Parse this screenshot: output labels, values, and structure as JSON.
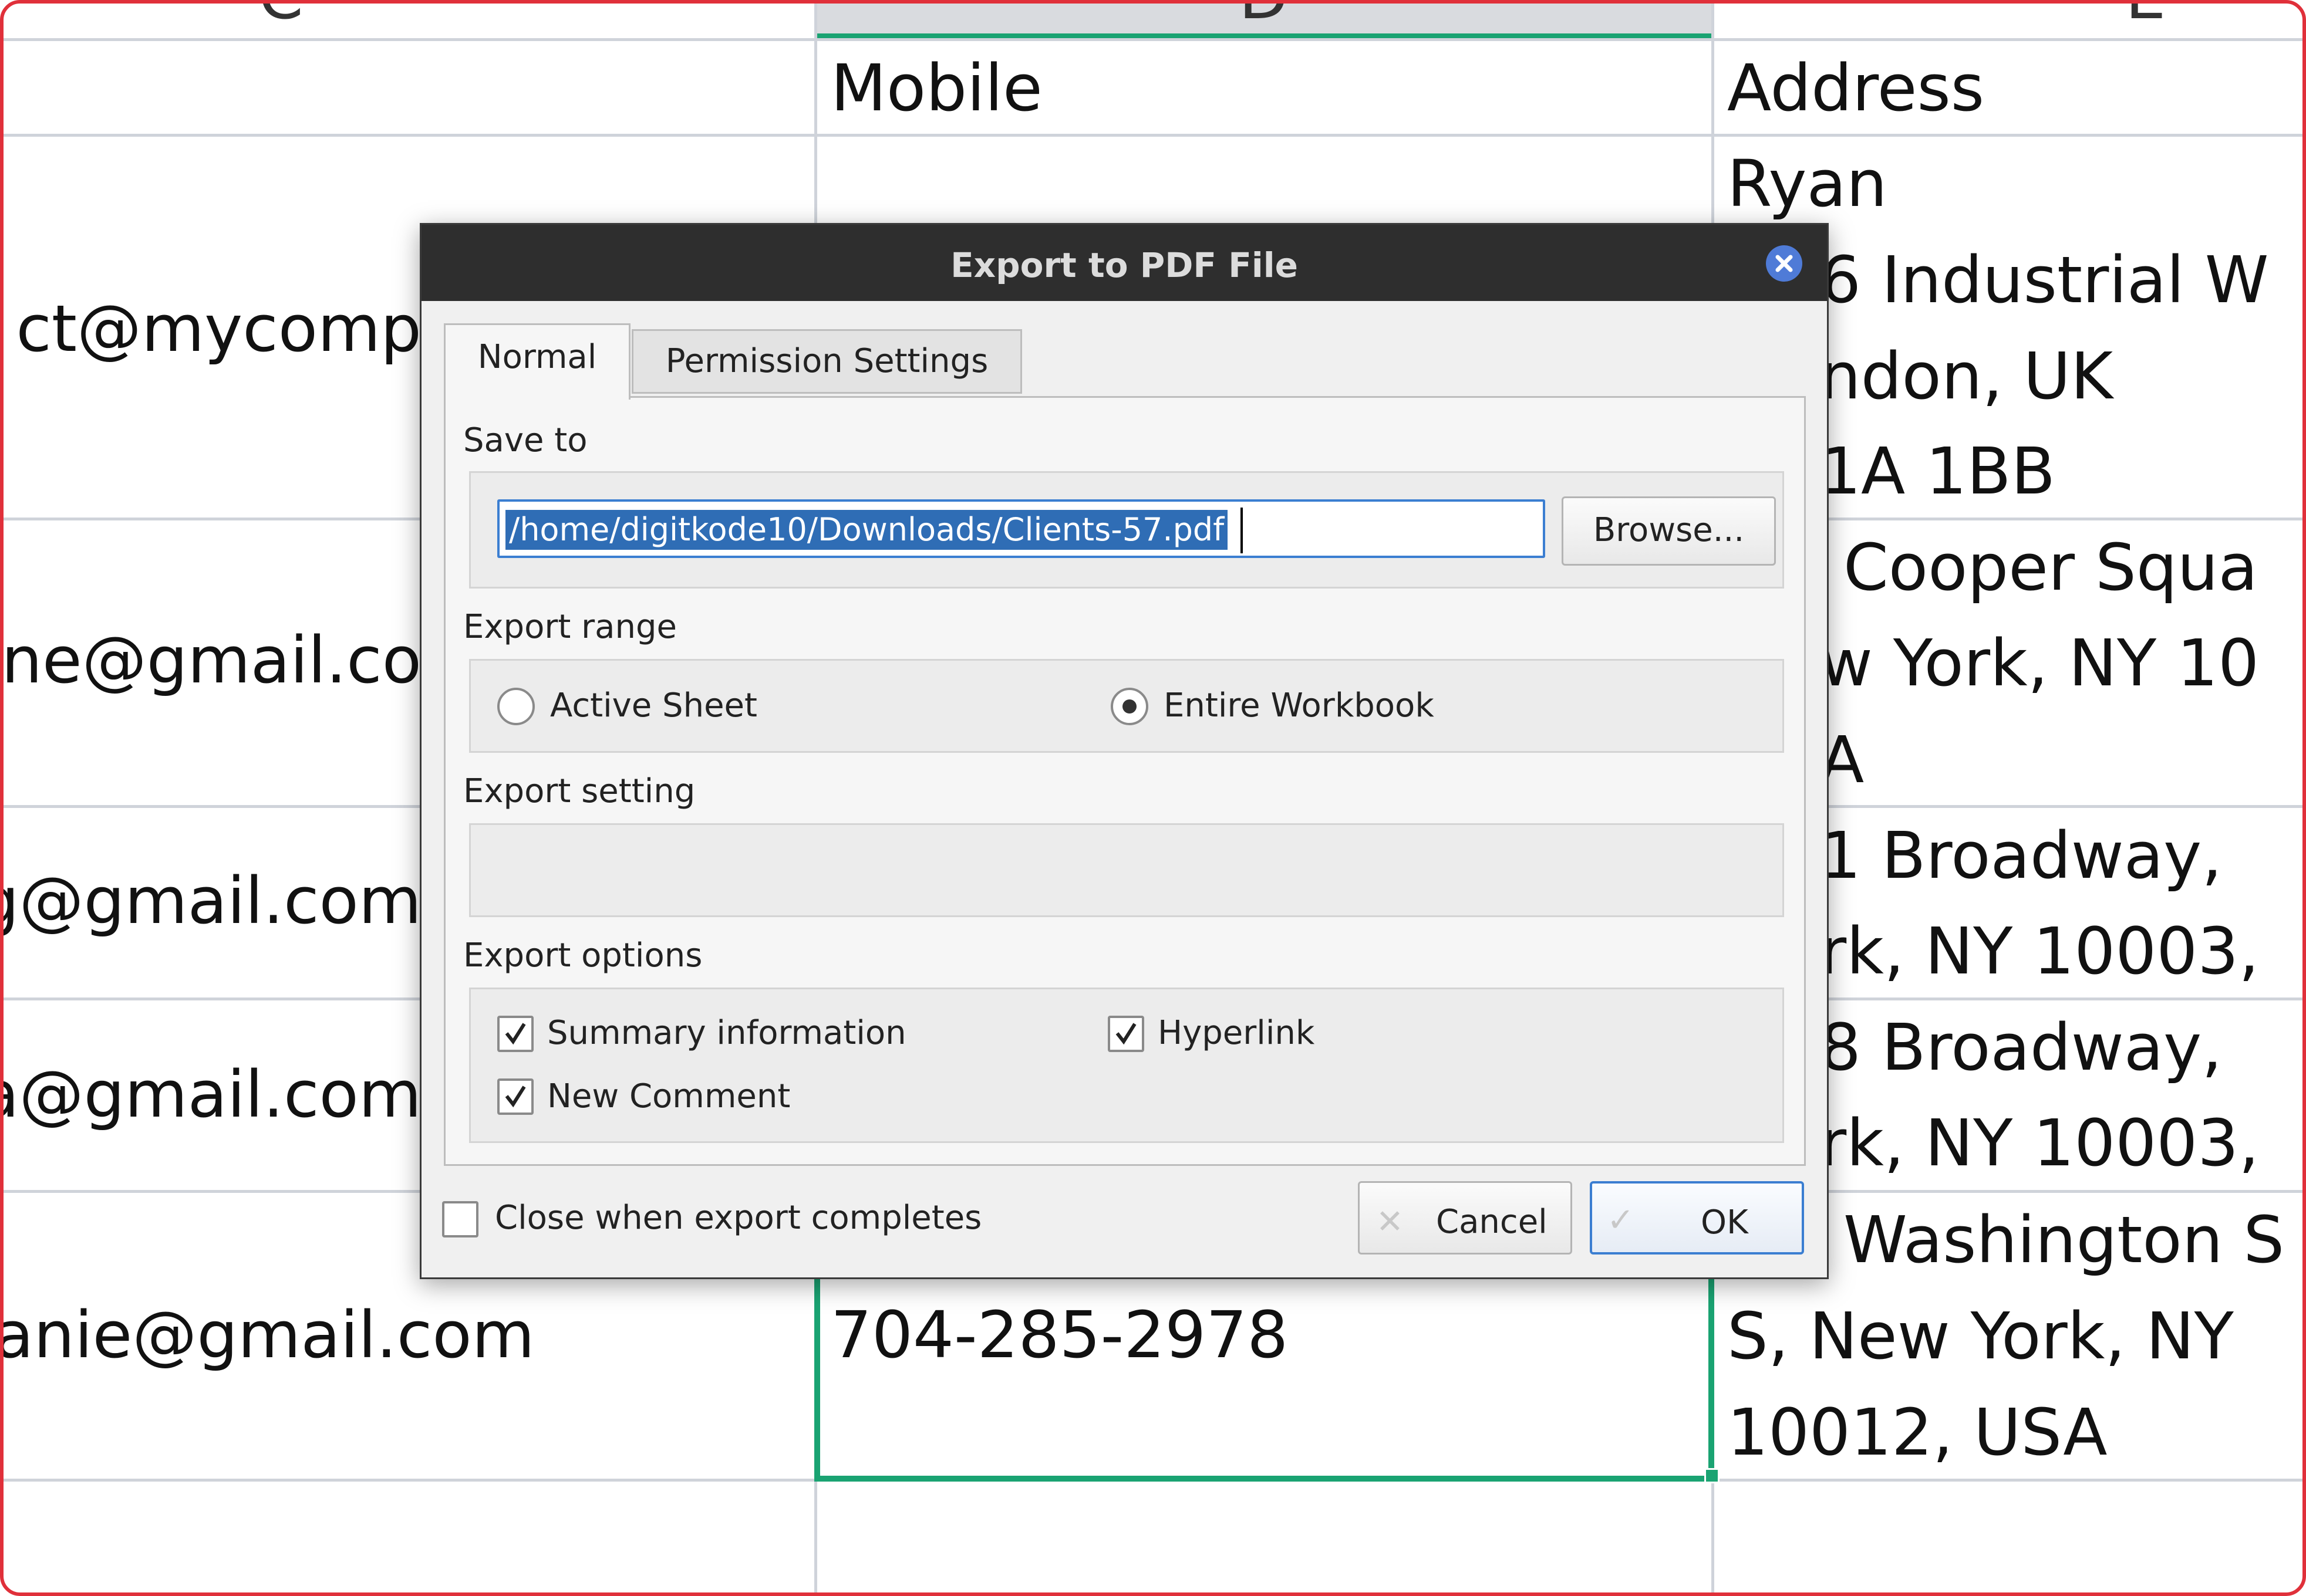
{
  "spreadsheet": {
    "column_headers": [
      "C",
      "D",
      "E"
    ],
    "header_row": {
      "mobile_label": "Mobile",
      "address_label": "Address"
    },
    "email_fragments": [
      "ct@mycomp",
      "ne@gmail.co",
      "g@gmail.com",
      "a@gmail.com",
      "anie@gmail.com"
    ],
    "address_fragments": [
      "Ryan",
      "6 Industrial W",
      "ndon, UK",
      "1A 1BB",
      "Cooper Squa",
      "w York, NY 10",
      "A",
      "1 Broadway, ",
      "rk, NY 10003,",
      "8 Broadway, ",
      "rk, NY 10003,",
      "Washington S",
      "S, New York, NY",
      "10012, USA"
    ],
    "selected_cell_value": "704-285-2978"
  },
  "dialog": {
    "title": "Export to PDF File",
    "tabs": [
      {
        "label": "Normal",
        "active": true
      },
      {
        "label": "Permission Settings",
        "active": false
      }
    ],
    "save_to": {
      "label": "Save to",
      "path_value": "/home/digitkode10/Downloads/Clients-57.pdf",
      "browse_label": "Browse..."
    },
    "export_range": {
      "label": "Export range",
      "options": [
        {
          "label": "Active Sheet",
          "selected": false
        },
        {
          "label": "Entire Workbook",
          "selected": true
        }
      ]
    },
    "export_setting": {
      "label": "Export setting"
    },
    "export_options": {
      "label": "Export options",
      "items": [
        {
          "label": "Summary information",
          "checked": true
        },
        {
          "label": "Hyperlink",
          "checked": true
        },
        {
          "label": "New Comment",
          "checked": true
        }
      ]
    },
    "close_when_complete": {
      "label": "Close when export completes",
      "checked": false
    },
    "cancel_label": "Cancel",
    "ok_label": "OK",
    "colors": {
      "titlebar": "#2e2e2e",
      "accent": "#3b7ed1",
      "selection": "#2f6db5",
      "sheet_selection": "#1aa372"
    }
  }
}
